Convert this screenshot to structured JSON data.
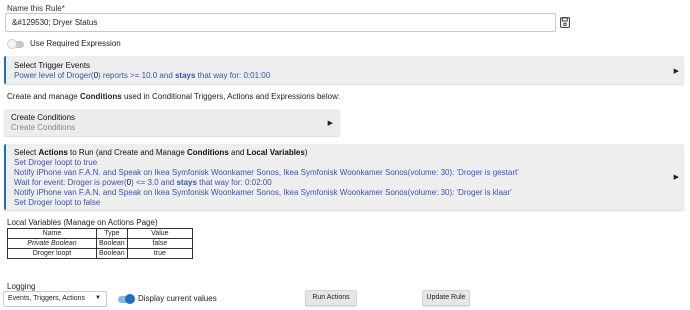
{
  "rule_name": {
    "label": "Name this Rule*",
    "value": "&#129530; Dryer Status",
    "save_icon": "save-icon"
  },
  "required_expression": {
    "label": "Use Required Expression",
    "enabled": false
  },
  "trigger": {
    "title": "Select Trigger Events",
    "desc_pre": "Power level of Droger(",
    "desc_num": "0",
    "desc_mid": ") reports >= 10.0 and ",
    "desc_bold": "stays",
    "desc_post": " that way for: 0:01:00"
  },
  "conditions_desc": {
    "pre": "Create and manage ",
    "bold": "Conditions",
    "post": " used in Conditional Triggers, Actions and Expressions below:"
  },
  "conditions_panel": {
    "title": "Create Conditions",
    "subtitle": "Create Conditions"
  },
  "actions": {
    "title_pre": "Select ",
    "title_b1": "Actions",
    "title_mid": " to Run (and Create and Manage ",
    "title_b2": "Conditions",
    "title_and": " and ",
    "title_b3": "Local Variables",
    "title_post": ")",
    "line1": "Set Droger loopt to true",
    "line2": "Notify iPhone van F.A.N. and Speak on Ikea Symfonisk Woonkamer Sonos, Ikea Symfonisk Woonkamer Sonos(volume: 30): 'Droger is gestart'",
    "line3_pre": "Wait for event: Droger is power(",
    "line3_num": "0",
    "line3_mid": ") <= 3.0 and ",
    "line3_bold": "stays",
    "line3_post": " that way for: 0:02:00",
    "line4": "Notify iPhone van F.A.N. and Speak on Ikea Symfonisk Woonkamer Sonos, Ikea Symfonisk Woonkamer Sonos(volume: 30): 'Droger is klaar'",
    "line5": "Set Droger loopt to false"
  },
  "local_variables": {
    "label": "Local Variables",
    "label_note": " (Manage on Actions Page)",
    "headers": [
      "Name",
      "Type",
      "Value"
    ],
    "rows": [
      {
        "name": "Private Boolean",
        "type": "Boolean",
        "value": "false"
      },
      {
        "name": "Droger loopt",
        "type": "Boolean",
        "value": "true"
      }
    ]
  },
  "logging": {
    "label": "Logging",
    "selected": "Events, Triggers, Actions",
    "display_label": "Display current values",
    "display_enabled": true
  },
  "buttons": {
    "run": "Run Actions",
    "update": "Update Rule"
  },
  "colors": {
    "accent": "#1e6fc0",
    "link_text": "#3a55b7",
    "panel_bg": "#eeeeee"
  }
}
